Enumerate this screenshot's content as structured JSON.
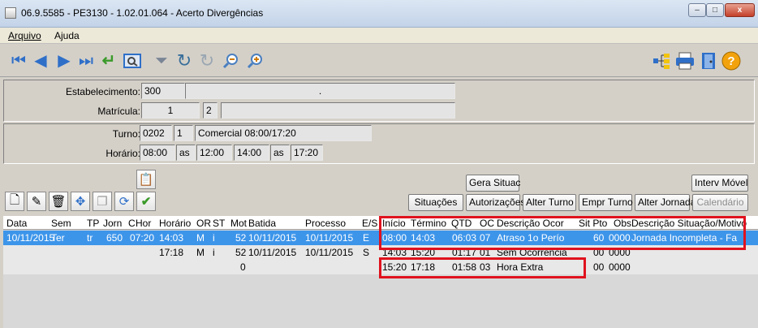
{
  "window": {
    "title": "06.9.5585 - PE3130 - 1.02.01.064 - Acerto Divergências",
    "min": "–",
    "max": "□",
    "close": "x"
  },
  "menu": {
    "arquivo": "Arquivo",
    "ajuda": "Ajuda"
  },
  "form": {
    "estabelecimento_label": "Estabelecimento:",
    "estabelecimento_code": "300",
    "estabelecimento_desc": ".",
    "matricula_label": "Matrícula:",
    "matricula_num": "1",
    "matricula_dig": "2",
    "matricula_name": "",
    "turno_label": "Turno:",
    "turno_code": "0202",
    "turno_num": "1",
    "turno_desc": "Comercial 08:00/17:20",
    "horario_label": "Horário:",
    "horario_1": "08:00",
    "as_1": "as",
    "horario_2": "12:00",
    "horario_3": "14:00",
    "as_2": "as",
    "horario_4": "17:20"
  },
  "buttons": {
    "gera_situac": "Gera Situac",
    "interv_movel": "Interv Móvel",
    "situacoes": "Situações",
    "autorizacoes": "Autorizações",
    "alter_turno": "Alter Turno",
    "empr_turno": "Empr Turno",
    "alter_jornada": "Alter Jornada",
    "calendario": "Calendário"
  },
  "grid": {
    "headers": [
      "Data",
      "Sem",
      "TP",
      "Jorn",
      "C",
      "Hor",
      "Horário",
      "OR",
      "ST",
      "Mot",
      "Batida",
      "Processo",
      "E/S",
      "Início",
      "Término",
      "QTD",
      "OC",
      "Descrição Ocor",
      "Sit Pto",
      "Obs",
      "Descrição Situação/Motivo"
    ],
    "rows": [
      {
        "data": "10/11/2015",
        "sem": "Ter",
        "tp": "tr",
        "jorn": "650",
        "hor": "07:20",
        "horario": "14:03",
        "or": "M",
        "st": "i",
        "mot": "52",
        "batida": "10/11/2015",
        "processo": "10/11/2015",
        "es": "E",
        "inicio": "08:00",
        "termino": "14:03",
        "qtd": "06:03",
        "oc": "07",
        "desc_ocor": "Atraso 1o Perío",
        "sit_pto": "60",
        "obs": "0000",
        "desc_sit": "Jornada Incompleta - Fa"
      },
      {
        "data": "",
        "sem": "",
        "tp": "",
        "jorn": "",
        "hor": "",
        "horario": "17:18",
        "or": "M",
        "st": "i",
        "mot": "52",
        "batida": "10/11/2015",
        "processo": "10/11/2015",
        "es": "S",
        "inicio": "14:03",
        "termino": "15:20",
        "qtd": "01:17",
        "oc": "01",
        "desc_ocor": "Sem Ocorrência",
        "sit_pto": "00",
        "obs": "0000",
        "desc_sit": ""
      },
      {
        "data": "",
        "sem": "",
        "tp": "",
        "jorn": "",
        "hor": "",
        "horario": "",
        "or": "",
        "st": "",
        "mot": "0",
        "batida": "",
        "processo": "",
        "es": "",
        "inicio": "15:20",
        "termino": "17:18",
        "qtd": "01:58",
        "oc": "03",
        "desc_ocor": "Hora Extra",
        "sit_pto": "00",
        "obs": "0000",
        "desc_sit": ""
      }
    ]
  },
  "icons": [
    "first-icon",
    "prev-icon",
    "next-icon",
    "last-icon",
    "goto-icon",
    "search-icon",
    "filter-icon",
    "undo-icon",
    "redo-icon",
    "zoom-out-icon",
    "zoom-in-icon",
    "tree-icon",
    "print-icon",
    "exit-icon",
    "help-icon"
  ],
  "colors": {
    "selected_row": "#3d95ea",
    "highlight_box": "#e0121e",
    "toolbar_blue": "#2f6fc8",
    "help_orange": "#f2a20c"
  }
}
